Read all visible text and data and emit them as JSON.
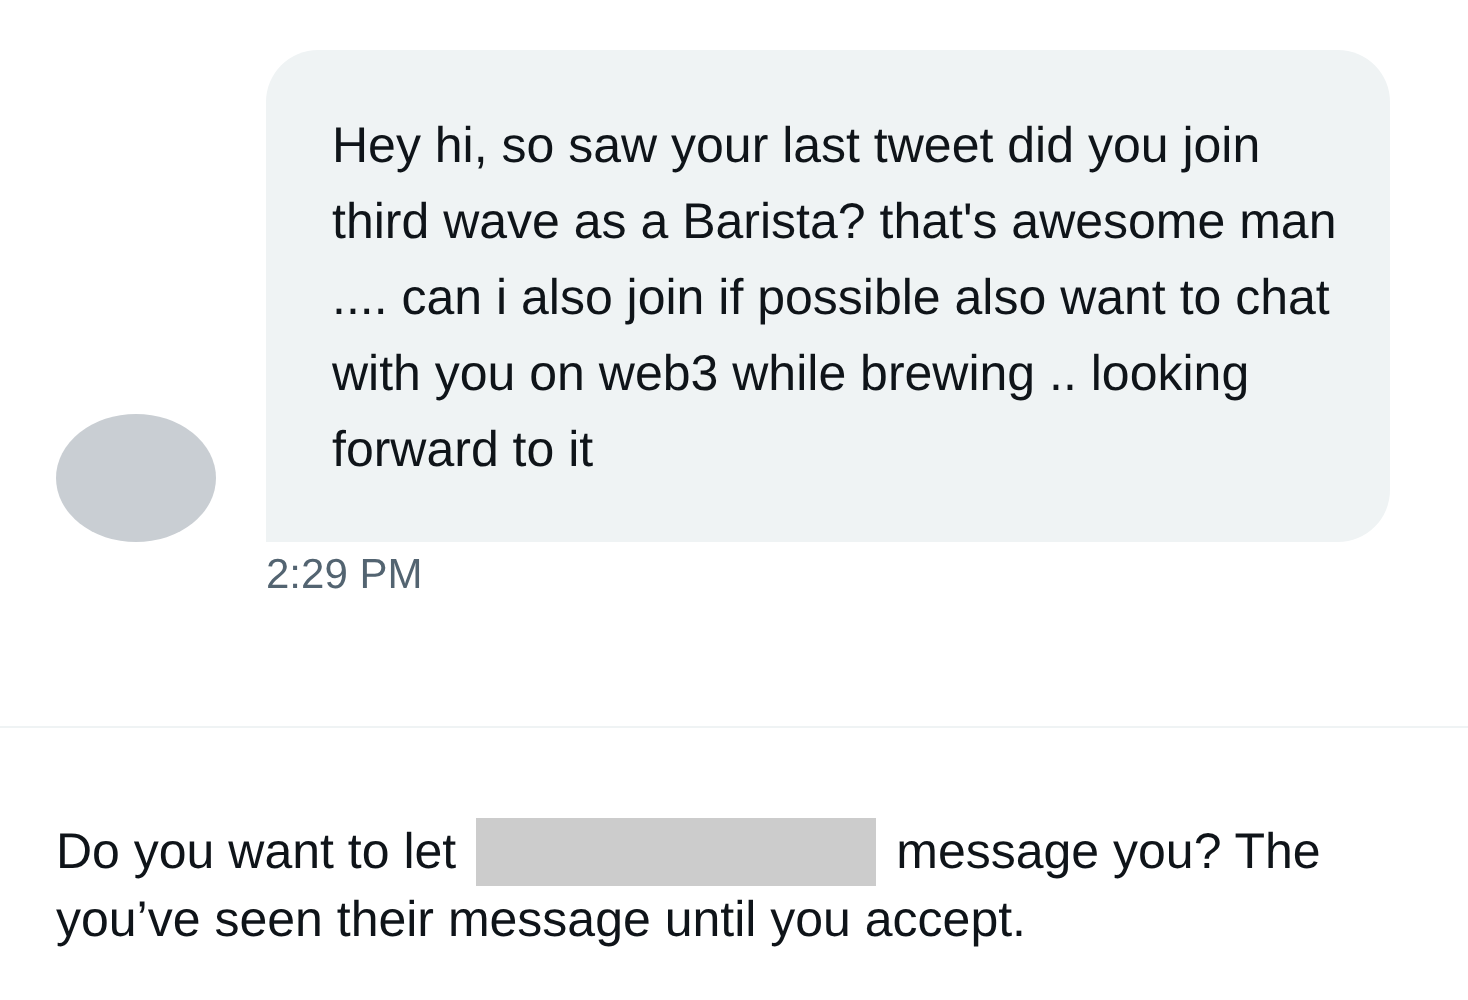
{
  "message": {
    "text": "Hey hi, so saw your last tweet did you join third wave as a Barista? that's awesome man .... can i also join if possible also want to chat with you on web3 while brewing .. looking forward to it",
    "time": "2:29 PM"
  },
  "request": {
    "before": "Do you want to let",
    "after": "message you? The",
    "second_line": "you’ve seen their message until you accept."
  }
}
